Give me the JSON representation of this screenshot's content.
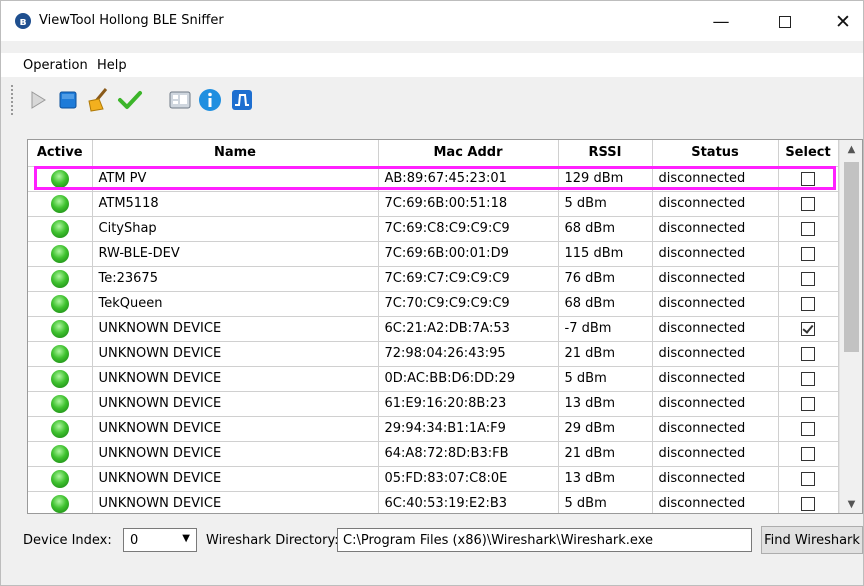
{
  "window": {
    "title": "ViewTool Hollong BLE Sniffer"
  },
  "menu": [
    "Operation",
    "Help"
  ],
  "toolbar": [
    "play-icon",
    "stop-icon",
    "broom-icon",
    "check-icon",
    "keyboard-icon",
    "info-icon",
    "waveform-icon"
  ],
  "colors": {
    "highlight": "#ff20ff",
    "led": "#3fc22f",
    "stop": "#1e7bd8"
  },
  "table": {
    "headers": {
      "active": "Active",
      "name": "Name",
      "mac": "Mac Addr",
      "rssi": "RSSI",
      "status": "Status",
      "select": "Select"
    },
    "rows": [
      {
        "name": "ATM PV",
        "mac": "AB:89:67:45:23:01",
        "rssi": "129 dBm",
        "status": "disconnected",
        "selected": false
      },
      {
        "name": "ATM5118",
        "mac": "7C:69:6B:00:51:18",
        "rssi": "5 dBm",
        "status": "disconnected",
        "selected": false
      },
      {
        "name": "CityShap",
        "mac": "7C:69:C8:C9:C9:C9",
        "rssi": "68 dBm",
        "status": "disconnected",
        "selected": false
      },
      {
        "name": "RW-BLE-DEV",
        "mac": "7C:69:6B:00:01:D9",
        "rssi": "115 dBm",
        "status": "disconnected",
        "selected": false
      },
      {
        "name": "Te:23675",
        "mac": "7C:69:C7:C9:C9:C9",
        "rssi": "76 dBm",
        "status": "disconnected",
        "selected": false
      },
      {
        "name": "TekQueen",
        "mac": "7C:70:C9:C9:C9:C9",
        "rssi": "68 dBm",
        "status": "disconnected",
        "selected": false
      },
      {
        "name": "UNKNOWN DEVICE",
        "mac": "6C:21:A2:DB:7A:53",
        "rssi": "-7 dBm",
        "status": "disconnected",
        "selected": true
      },
      {
        "name": "UNKNOWN DEVICE",
        "mac": "72:98:04:26:43:95",
        "rssi": "21 dBm",
        "status": "disconnected",
        "selected": false
      },
      {
        "name": "UNKNOWN DEVICE",
        "mac": "0D:AC:BB:D6:DD:29",
        "rssi": "5 dBm",
        "status": "disconnected",
        "selected": false
      },
      {
        "name": "UNKNOWN DEVICE",
        "mac": "61:E9:16:20:8B:23",
        "rssi": "13 dBm",
        "status": "disconnected",
        "selected": false
      },
      {
        "name": "UNKNOWN DEVICE",
        "mac": "29:94:34:B1:1A:F9",
        "rssi": "29 dBm",
        "status": "disconnected",
        "selected": false
      },
      {
        "name": "UNKNOWN DEVICE",
        "mac": "64:A8:72:8D:B3:FB",
        "rssi": "21 dBm",
        "status": "disconnected",
        "selected": false
      },
      {
        "name": "UNKNOWN DEVICE",
        "mac": "05:FD:83:07:C8:0E",
        "rssi": "13 dBm",
        "status": "disconnected",
        "selected": false
      },
      {
        "name": "UNKNOWN DEVICE",
        "mac": "6C:40:53:19:E2:B3",
        "rssi": "5 dBm",
        "status": "disconnected",
        "selected": false
      }
    ]
  },
  "bottom": {
    "device_index_label": "Device Index:",
    "device_index_value": "0",
    "wireshark_label": "Wireshark Directory:",
    "wireshark_path": "C:\\Program Files (x86)\\Wireshark\\Wireshark.exe",
    "find_button": "Find Wireshark"
  }
}
